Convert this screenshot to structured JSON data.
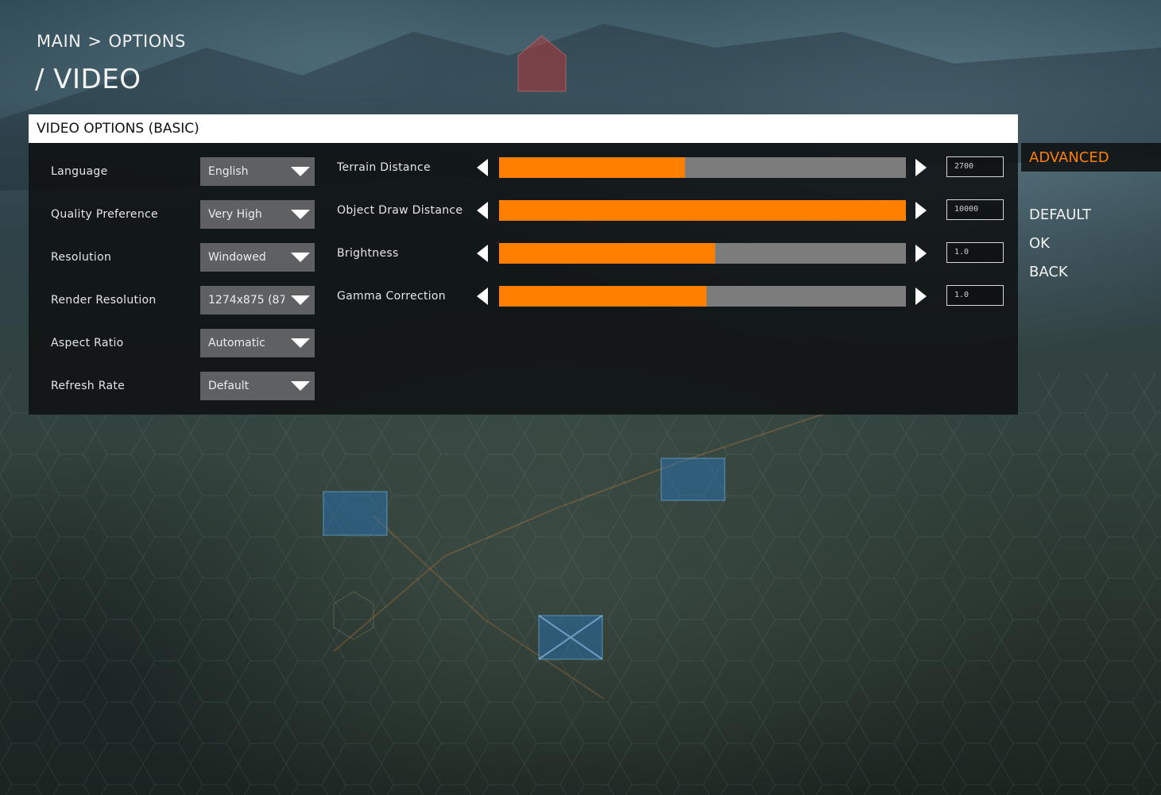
{
  "breadcrumb": {
    "main": "MAIN",
    "separator": ">",
    "options": "OPTIONS"
  },
  "page_title": "/ VIDEO",
  "panel": {
    "title": "VIDEO OPTIONS (BASIC)"
  },
  "options": [
    {
      "label": "Language",
      "value": "English"
    },
    {
      "label": "Quality Preference",
      "value": "Very High"
    },
    {
      "label": "Resolution",
      "value": "Windowed"
    },
    {
      "label": "Render Resolution",
      "value": "1274x875 (87"
    },
    {
      "label": "Aspect Ratio",
      "value": "Automatic"
    },
    {
      "label": "Refresh Rate",
      "value": "Default"
    }
  ],
  "sliders": [
    {
      "label": "Terrain Distance",
      "value": "2700",
      "fill_fraction": 0.457
    },
    {
      "label": "Object Draw Distance",
      "value": "10000",
      "fill_fraction": 1.0
    },
    {
      "label": "Brightness",
      "value": "1.0",
      "fill_fraction": 0.531
    },
    {
      "label": "Gamma Correction",
      "value": "1.0",
      "fill_fraction": 0.51
    }
  ],
  "side_menu": {
    "advanced": "ADVANCED",
    "default": "DEFAULT",
    "ok": "OK",
    "back": "BACK"
  },
  "colors": {
    "accent": "#ff7f00",
    "track": "#7c7c7c",
    "select_bg": "#5e6062",
    "panel_header_bg": "#ffffff"
  },
  "icons": {
    "dropdown": "dropdown-caret-icon",
    "decrease": "arrow-left-icon",
    "increase": "arrow-right-icon"
  }
}
